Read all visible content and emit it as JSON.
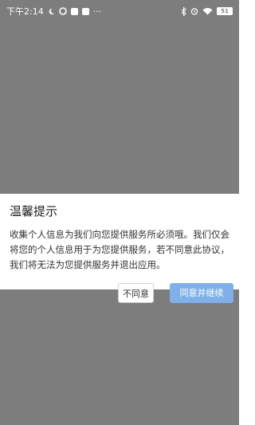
{
  "status_bar": {
    "time": "下午2:14",
    "more": "···",
    "battery": "51"
  },
  "dialog": {
    "title": "温馨提示",
    "body": "收集个人信息为我们向您提供服务所必须哦。我们仅会将您的个人信息用于为您提供服务，若不同意此协议，我们将无法为您提供服务并退出应用。",
    "disagree_label": "不同意",
    "agree_label": "同意并继续"
  },
  "colors": {
    "overlay": "#7d7d7d",
    "dialog_bg": "#ffffff",
    "agree_button": "#7fb0ea"
  }
}
